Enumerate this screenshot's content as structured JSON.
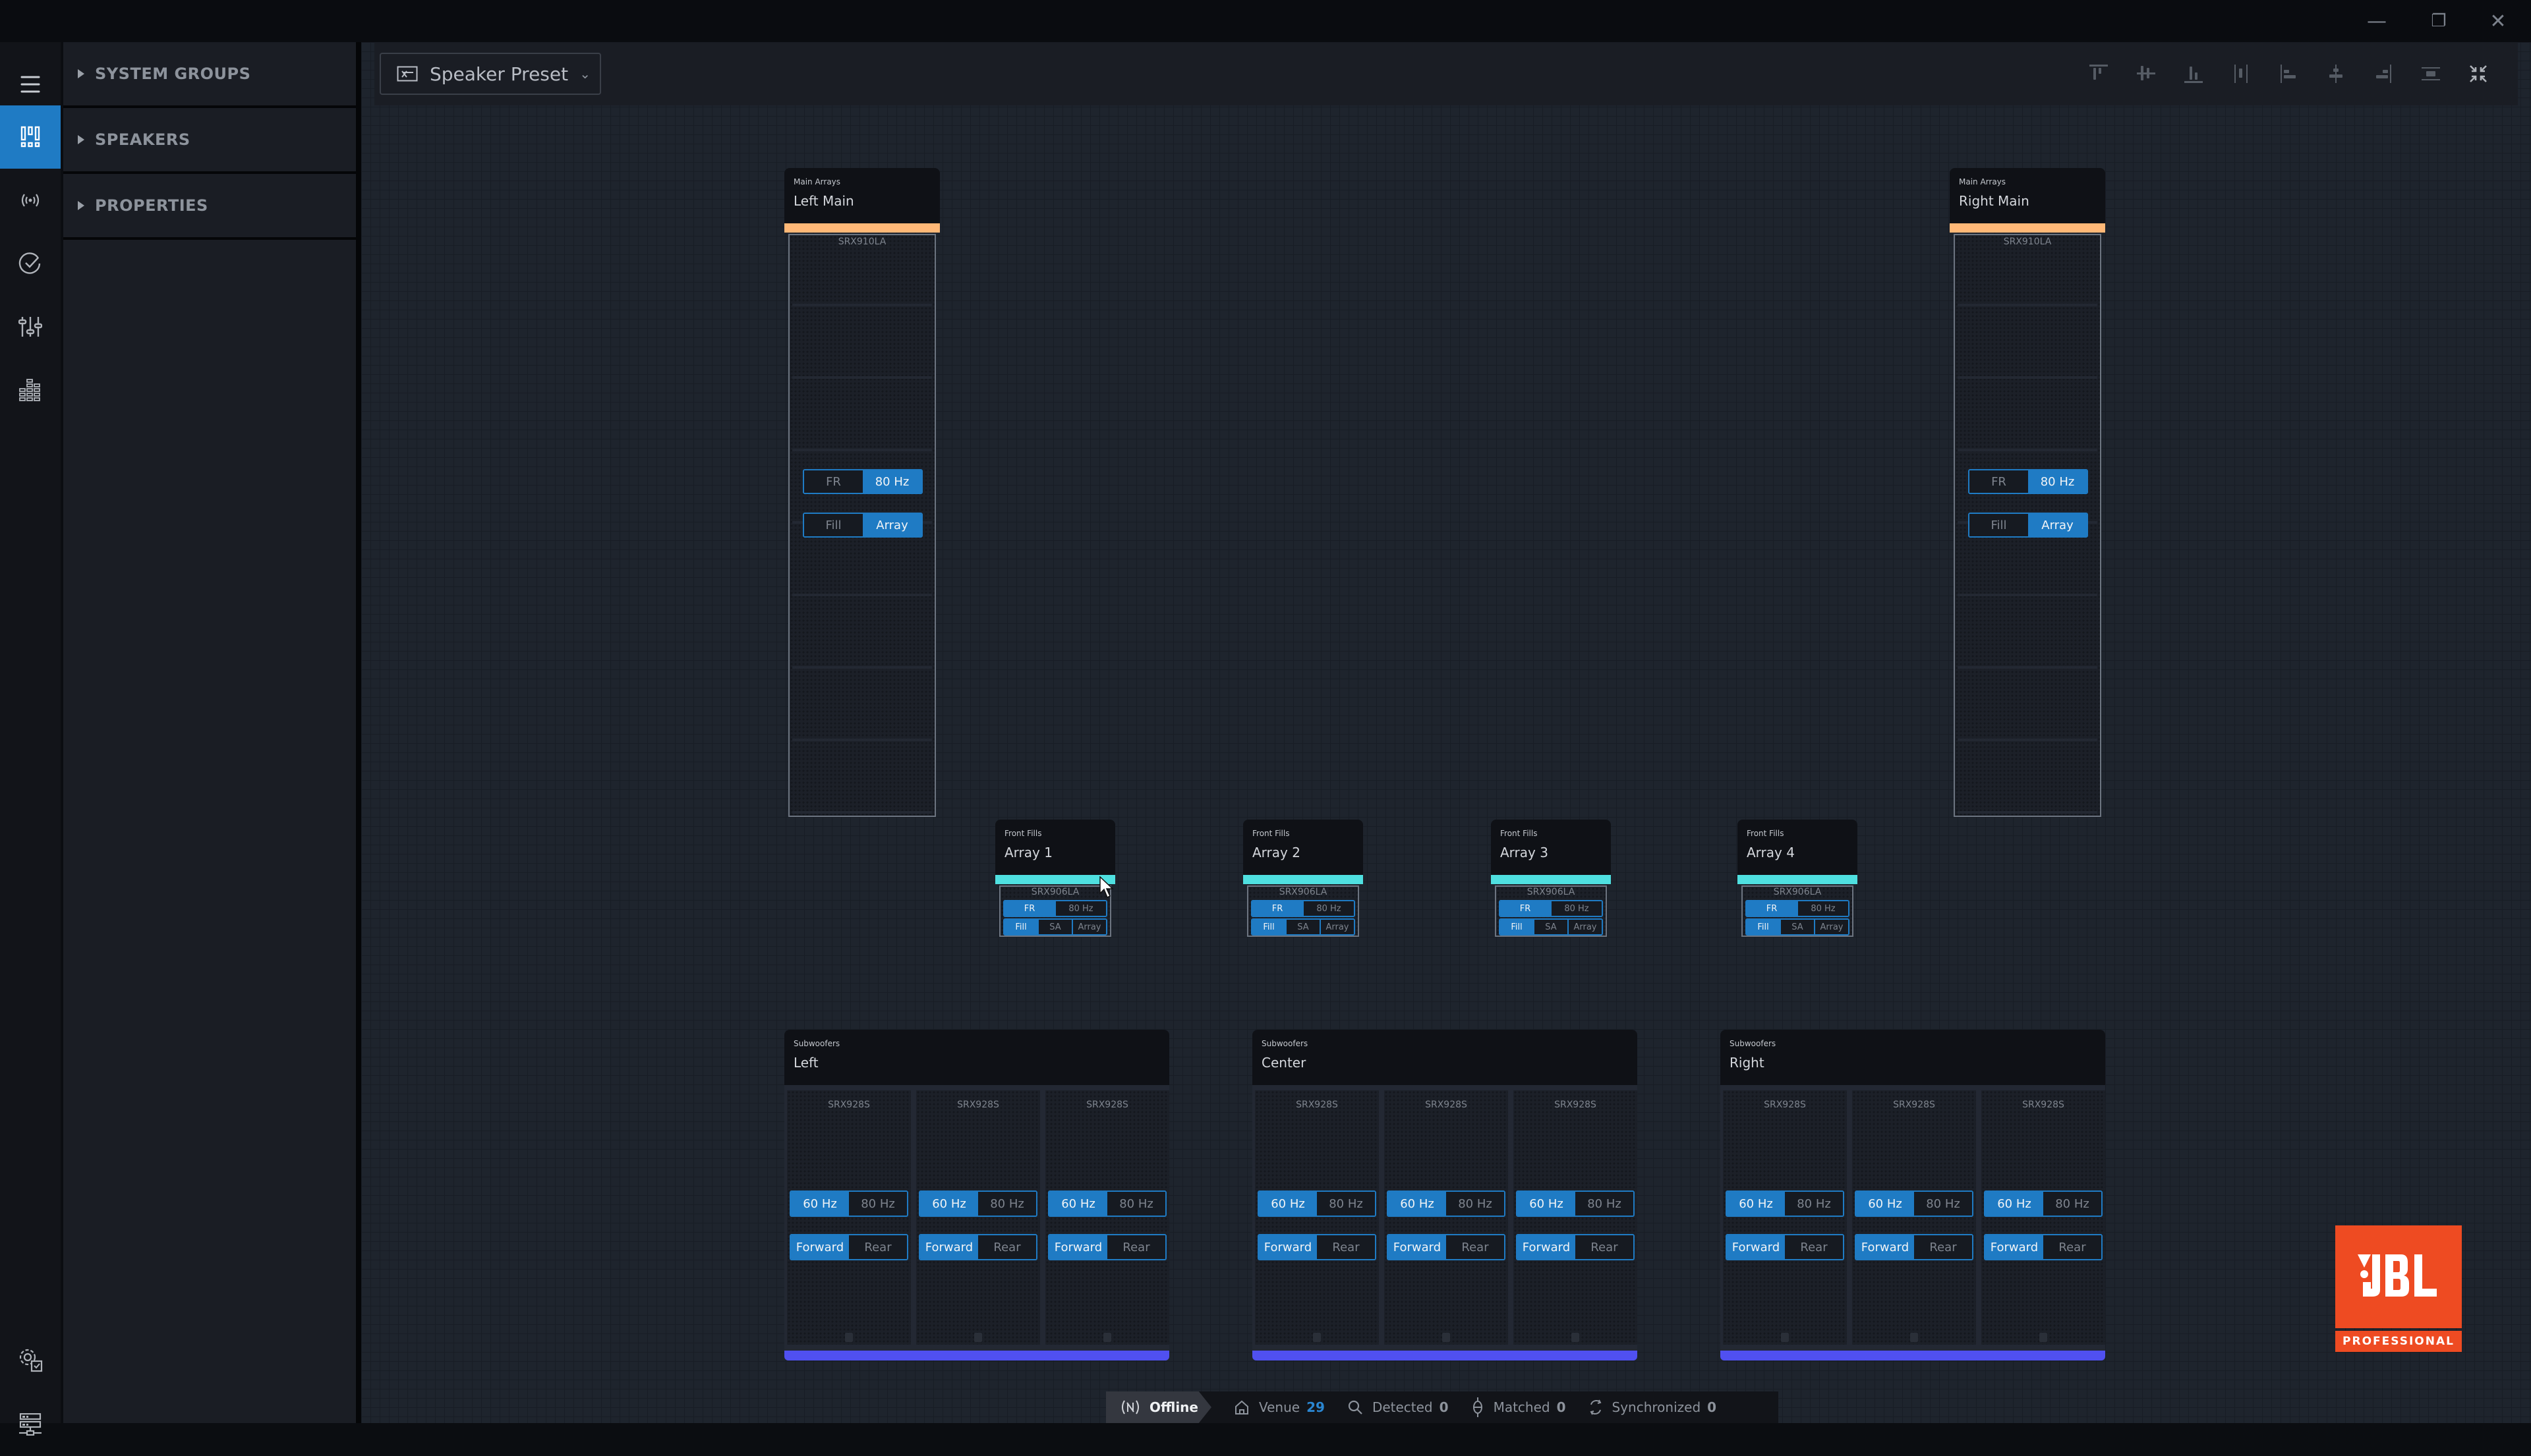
{
  "window": {
    "controls": {
      "minimize": "—",
      "restore": "❐",
      "close": "✕"
    }
  },
  "rail": {
    "items": [
      {
        "id": "menu",
        "icon": "hamburger-menu-icon"
      },
      {
        "id": "speakers-view",
        "icon": "speaker-layout-icon",
        "active": true
      },
      {
        "id": "network",
        "icon": "broadcast-icon"
      },
      {
        "id": "check",
        "icon": "checkmark-circle-icon"
      },
      {
        "id": "mixer",
        "icon": "sliders-icon"
      },
      {
        "id": "meters",
        "icon": "level-meter-icon"
      }
    ],
    "bottom_items": [
      {
        "id": "settings",
        "icon": "settings-check-icon"
      },
      {
        "id": "devices",
        "icon": "server-network-icon"
      }
    ]
  },
  "sidebar": {
    "sections": [
      {
        "label": "SYSTEM GROUPS"
      },
      {
        "label": "SPEAKERS"
      },
      {
        "label": "PROPERTIES"
      }
    ]
  },
  "toolbar": {
    "preset_label": "Speaker Preset",
    "preset_icon": "preset-icon",
    "align_tools": [
      "align-top-icon",
      "align-vertical-center-icon",
      "align-bottom-icon",
      "distribute-horizontal-icon",
      "align-left-icon",
      "align-horizontal-center-icon",
      "align-right-icon",
      "distribute-vertical-icon",
      "collapse-icon"
    ]
  },
  "main_arrays": [
    {
      "category": "Main Arrays",
      "name": "Left Main",
      "model": "SRX910LA",
      "cabinets": 8,
      "bar_color": "#ffb877",
      "crossover": {
        "options": [
          "FR",
          "80 Hz"
        ],
        "selected": "80 Hz"
      },
      "mode": {
        "options": [
          "Fill",
          "Array"
        ],
        "selected": "Array"
      }
    },
    {
      "category": "Main Arrays",
      "name": "Right Main",
      "model": "SRX910LA",
      "cabinets": 8,
      "bar_color": "#ffb877",
      "crossover": {
        "options": [
          "FR",
          "80 Hz"
        ],
        "selected": "80 Hz"
      },
      "mode": {
        "options": [
          "Fill",
          "Array"
        ],
        "selected": "Array"
      }
    }
  ],
  "front_fills": [
    {
      "category": "Front Fills",
      "name": "Array 1",
      "model": "SRX906LA",
      "bar_color": "#4fe0e0",
      "crossover": {
        "options": [
          "FR",
          "80 Hz"
        ],
        "selected": "FR"
      },
      "mode": {
        "options": [
          "Fill",
          "SA",
          "Array"
        ],
        "selected": "Fill"
      }
    },
    {
      "category": "Front Fills",
      "name": "Array 2",
      "model": "SRX906LA",
      "bar_color": "#4fe0e0",
      "crossover": {
        "options": [
          "FR",
          "80 Hz"
        ],
        "selected": "FR"
      },
      "mode": {
        "options": [
          "Fill",
          "SA",
          "Array"
        ],
        "selected": "Fill"
      }
    },
    {
      "category": "Front Fills",
      "name": "Array 3",
      "model": "SRX906LA",
      "bar_color": "#4fe0e0",
      "crossover": {
        "options": [
          "FR",
          "80 Hz"
        ],
        "selected": "FR"
      },
      "mode": {
        "options": [
          "Fill",
          "SA",
          "Array"
        ],
        "selected": "Fill"
      }
    },
    {
      "category": "Front Fills",
      "name": "Array 4",
      "model": "SRX906LA",
      "bar_color": "#4fe0e0",
      "crossover": {
        "options": [
          "FR",
          "80 Hz"
        ],
        "selected": "FR"
      },
      "mode": {
        "options": [
          "Fill",
          "SA",
          "Array"
        ],
        "selected": "Fill"
      }
    }
  ],
  "subwoofers": [
    {
      "category": "Subwoofers",
      "name": "Left",
      "bar_color": "#5050f0",
      "units": [
        {
          "model": "SRX928S",
          "freq": {
            "options": [
              "60 Hz",
              "80 Hz"
            ],
            "selected": "60 Hz"
          },
          "dir": {
            "options": [
              "Forward",
              "Rear"
            ],
            "selected": "Forward"
          }
        },
        {
          "model": "SRX928S",
          "freq": {
            "options": [
              "60 Hz",
              "80 Hz"
            ],
            "selected": "60 Hz"
          },
          "dir": {
            "options": [
              "Forward",
              "Rear"
            ],
            "selected": "Forward"
          }
        },
        {
          "model": "SRX928S",
          "freq": {
            "options": [
              "60 Hz",
              "80 Hz"
            ],
            "selected": "60 Hz"
          },
          "dir": {
            "options": [
              "Forward",
              "Rear"
            ],
            "selected": "Forward"
          }
        }
      ]
    },
    {
      "category": "Subwoofers",
      "name": "Center",
      "bar_color": "#5050f0",
      "units": [
        {
          "model": "SRX928S",
          "freq": {
            "options": [
              "60 Hz",
              "80 Hz"
            ],
            "selected": "60 Hz"
          },
          "dir": {
            "options": [
              "Forward",
              "Rear"
            ],
            "selected": "Forward"
          }
        },
        {
          "model": "SRX928S",
          "freq": {
            "options": [
              "60 Hz",
              "80 Hz"
            ],
            "selected": "60 Hz"
          },
          "dir": {
            "options": [
              "Forward",
              "Rear"
            ],
            "selected": "Forward"
          }
        },
        {
          "model": "SRX928S",
          "freq": {
            "options": [
              "60 Hz",
              "80 Hz"
            ],
            "selected": "60 Hz"
          },
          "dir": {
            "options": [
              "Forward",
              "Rear"
            ],
            "selected": "Forward"
          }
        }
      ]
    },
    {
      "category": "Subwoofers",
      "name": "Right",
      "bar_color": "#5050f0",
      "units": [
        {
          "model": "SRX928S",
          "freq": {
            "options": [
              "60 Hz",
              "80 Hz"
            ],
            "selected": "60 Hz"
          },
          "dir": {
            "options": [
              "Forward",
              "Rear"
            ],
            "selected": "Forward"
          }
        },
        {
          "model": "SRX928S",
          "freq": {
            "options": [
              "60 Hz",
              "80 Hz"
            ],
            "selected": "60 Hz"
          },
          "dir": {
            "options": [
              "Forward",
              "Rear"
            ],
            "selected": "Forward"
          }
        },
        {
          "model": "SRX928S",
          "freq": {
            "options": [
              "60 Hz",
              "80 Hz"
            ],
            "selected": "60 Hz"
          },
          "dir": {
            "options": [
              "Forward",
              "Rear"
            ],
            "selected": "Forward"
          }
        }
      ]
    }
  ],
  "status": {
    "connection": "Offline",
    "venue_label": "Venue",
    "venue_count": "29",
    "detected_label": "Detected",
    "detected_count": "0",
    "matched_label": "Matched",
    "matched_count": "0",
    "synchronized_label": "Synchronized",
    "synchronized_count": "0"
  },
  "logo": {
    "brand": "JBL",
    "sub": "PROFESSIONAL",
    "color": "#ee4b22"
  },
  "colors": {
    "accent": "#1f7bc4",
    "main_bar": "#ffb877",
    "fill_bar": "#4fe0e0",
    "sub_bar": "#5050f0"
  }
}
